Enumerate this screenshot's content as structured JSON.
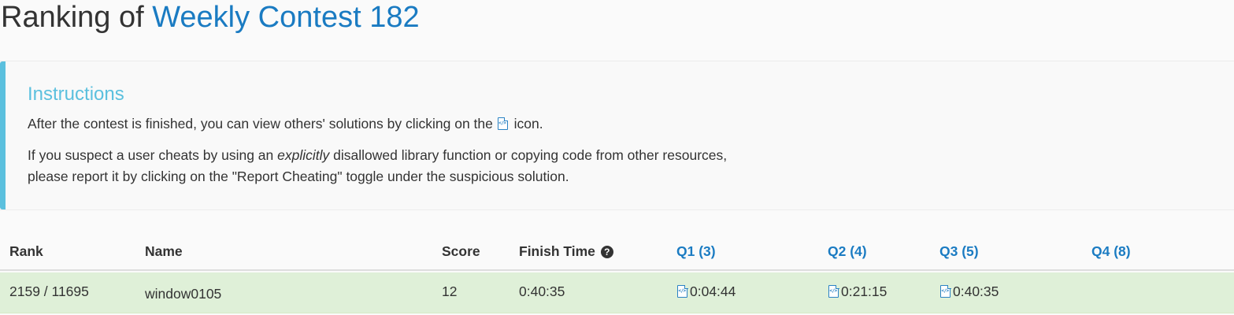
{
  "header": {
    "title_prefix": "Ranking of",
    "contest_link": "Weekly Contest 182"
  },
  "instructions": {
    "title": "Instructions",
    "p1_before": "After the contest is finished, you can view others' solutions by clicking on the",
    "p1_after": "icon.",
    "p2_before": "If you suspect a user cheats by using an",
    "p2_em": "explicitly",
    "p2_after": "disallowed library function or copying code from other resources,",
    "p3": "please report it by clicking on the \"Report Cheating\" toggle under the suspicious solution."
  },
  "table": {
    "headers": {
      "rank": "Rank",
      "name": "Name",
      "score": "Score",
      "finish_time": "Finish Time",
      "q1": "Q1 (3)",
      "q2": "Q2 (4)",
      "q3": "Q3 (5)",
      "q4": "Q4 (8)"
    },
    "help_icon": "question-circle-icon",
    "row": {
      "rank": "2159 / 11695",
      "name": "window0105",
      "score": "12",
      "finish_time": "0:40:35",
      "q1": "0:04:44",
      "q2": "0:21:15",
      "q3": "0:40:35",
      "q4": ""
    },
    "solution_icon": "code-file-icon"
  },
  "colors": {
    "link": "#1a7bc2",
    "info": "#5bc0de",
    "success_row": "#dff0d8"
  }
}
